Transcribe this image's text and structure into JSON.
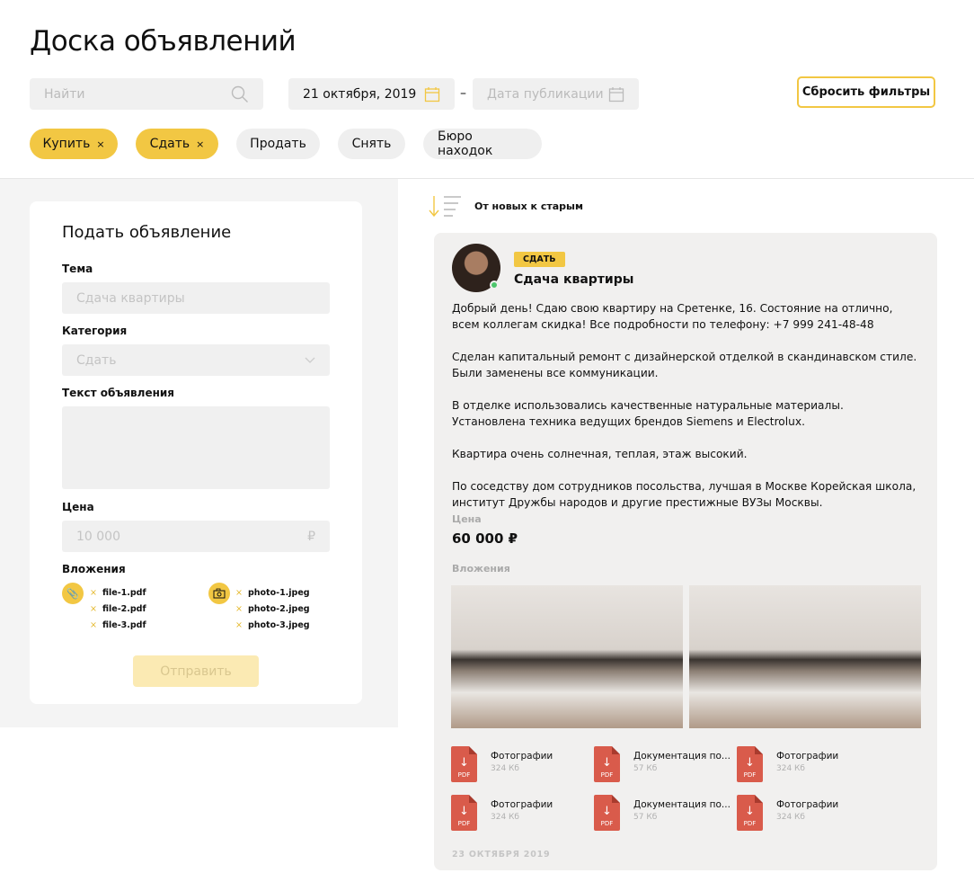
{
  "header": {
    "title": "Доска объявлений",
    "search_placeholder": "Найти",
    "date_from": "21 октября, 2019",
    "date_sep": "–",
    "date_to_placeholder": "Дата публикации",
    "reset_label": "Сбросить фильтры"
  },
  "chips": [
    {
      "label": "Купить",
      "active": true
    },
    {
      "label": "Сдать",
      "active": true
    },
    {
      "label": "Продать",
      "active": false
    },
    {
      "label": "Снять",
      "active": false
    },
    {
      "label": "Бюро находок",
      "active": false
    }
  ],
  "chip_close": "×",
  "form": {
    "title": "Подать объявление",
    "topic_label": "Тема",
    "topic_placeholder": "Сдача квартиры",
    "category_label": "Категория",
    "category_value": "Сдать",
    "text_label": "Текст объявления",
    "price_label": "Цена",
    "price_placeholder": "10 000",
    "currency": "₽",
    "attachments_label": "Вложения",
    "files": [
      "file-1.pdf",
      "file-2.pdf",
      "file-3.pdf"
    ],
    "photos": [
      "photo-1.jpeg",
      "photo-2.jpeg",
      "photo-3.jpeg"
    ],
    "remove": "×",
    "submit": "Отправить"
  },
  "sort": {
    "label": "От новых к старым"
  },
  "post": {
    "badge": "СДАТЬ",
    "title": "Сдача квартиры",
    "paragraphs": [
      "Добрый день! Сдаю свою квартиру на Сретенке, 16. Состояние на отлично, всем коллегам скидка! Все подробности по телефону: +7 999 241-48-48",
      "Сделан капитальный ремонт с дизайнерской отделкой в скандинавском стиле. Были заменены все коммуникации.",
      "В отделке использовались качественные натуральные материалы. Установлена техника ведущих брендов Siemens и Electrolux.",
      "Квартира очень солнечная, теплая, этаж высокий.",
      "По соседству дом сотрудников посольства, лучшая в Москве Корейская школа, институт Дружбы народов и другие престижные ВУЗы Москвы."
    ],
    "price_label": "Цена",
    "price": "60 000 ₽",
    "attachments_label": "Вложения",
    "files": [
      {
        "name": "Фотографии",
        "size": "324 Кб"
      },
      {
        "name": "Документация по...",
        "size": "57 Кб"
      },
      {
        "name": "Фотографии",
        "size": "324 Кб"
      },
      {
        "name": "Фотографии",
        "size": "324 Кб"
      },
      {
        "name": "Документация по...",
        "size": "57 Кб"
      },
      {
        "name": "Фотографии",
        "size": "324 Кб"
      }
    ],
    "pdf_label": "PDF",
    "date": "23 ОКТЯБРЯ 2019"
  },
  "colors": {
    "accent": "#f2c743",
    "pdf": "#d95b4b",
    "online": "#4cc56b"
  }
}
